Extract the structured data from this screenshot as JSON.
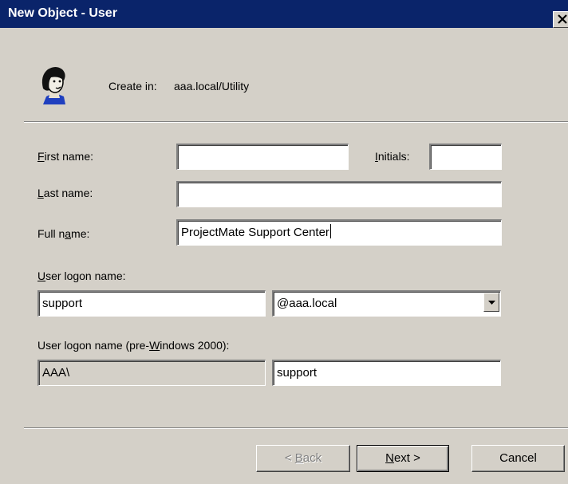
{
  "window": {
    "title": "New Object - User"
  },
  "header": {
    "create_in_label": "Create in:",
    "create_in_value": "aaa.local/Utility"
  },
  "form": {
    "first_name": {
      "label_mnemonic": "F",
      "label_rest": "irst name:",
      "value": ""
    },
    "initials": {
      "label_mnemonic": "I",
      "label_rest": "nitials:",
      "value": ""
    },
    "last_name": {
      "label_mnemonic": "L",
      "label_rest": "ast name:",
      "value": ""
    },
    "full_name": {
      "label_pre": "Full n",
      "label_mnemonic": "a",
      "label_rest": "me:",
      "value": "ProjectMate Support Center"
    },
    "logon_name": {
      "label_mnemonic": "U",
      "label_rest": "ser logon name:",
      "value": "support"
    },
    "upn_suffix": {
      "selected": "@aaa.local"
    },
    "pre2000": {
      "label_pre": "User logon name (pre-",
      "label_mnemonic": "W",
      "label_rest": "indows 2000):",
      "domain_value": "AAA\\",
      "value": "support"
    }
  },
  "buttons": {
    "back": {
      "pre": "< ",
      "mnemonic": "B",
      "rest": "ack"
    },
    "next": {
      "mnemonic": "N",
      "rest": "ext >"
    },
    "cancel": "Cancel"
  },
  "colors": {
    "titlebar": "#0a246a",
    "dialog_bg": "#d4d0c8"
  },
  "icons": {
    "title_close": "close-icon",
    "user": "user-avatar-icon",
    "dropdown": "chevron-down-icon"
  }
}
